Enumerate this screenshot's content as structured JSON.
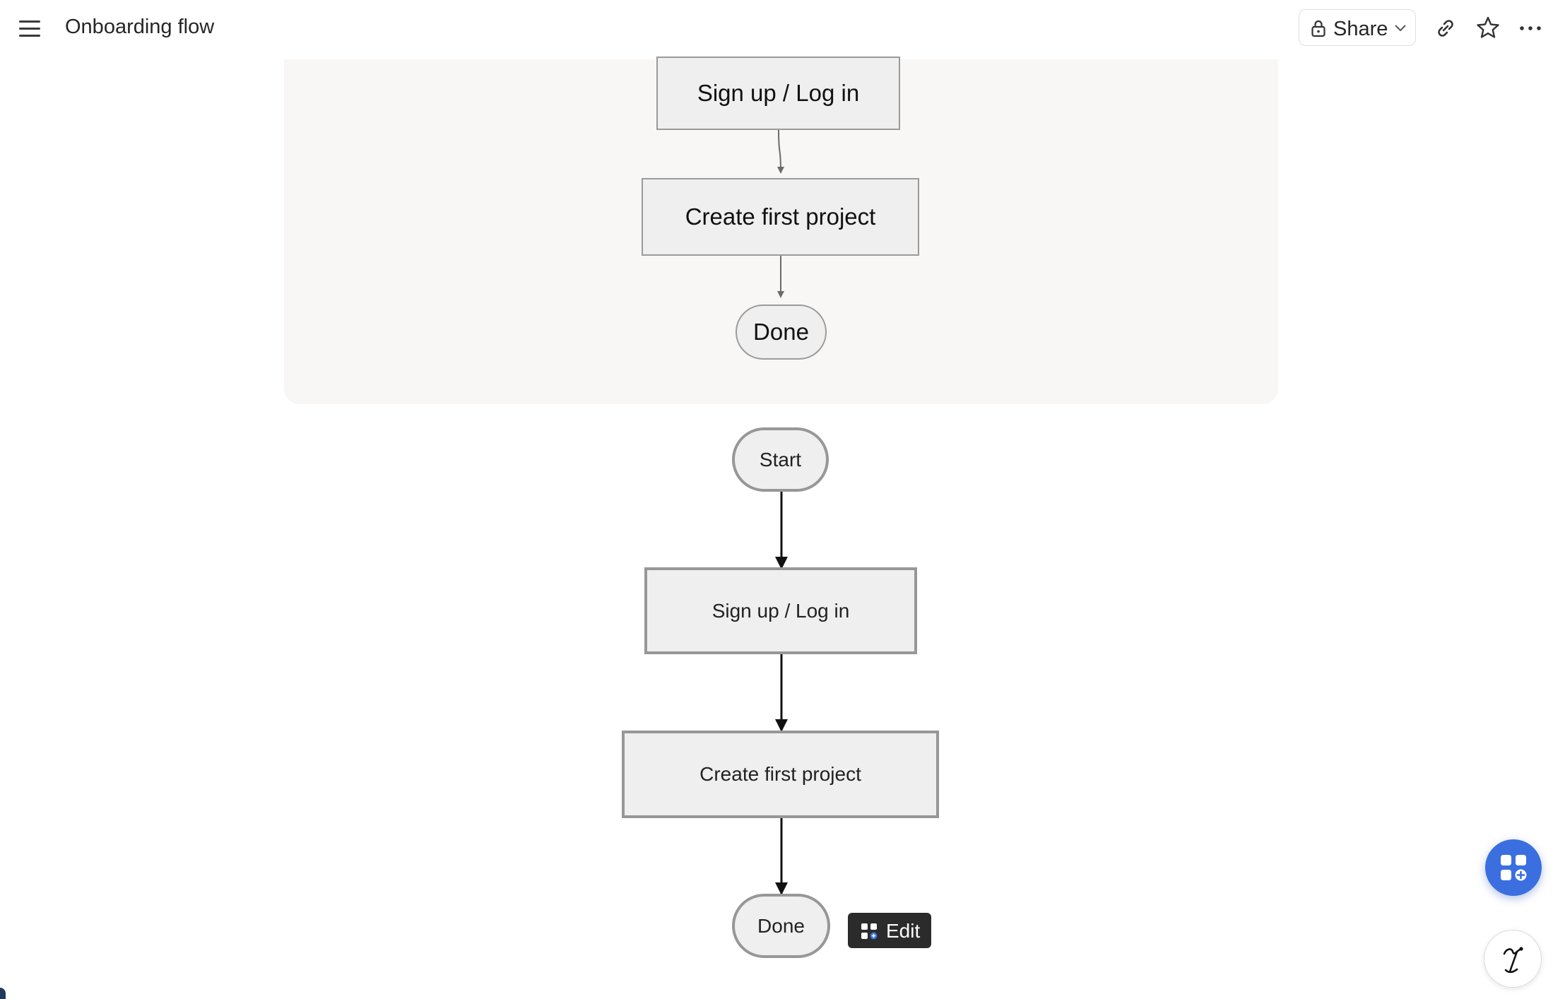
{
  "header": {
    "title": "Onboarding flow",
    "share_label": "Share"
  },
  "embedded_diagram": {
    "nodes": {
      "signup": "Sign up / Log in",
      "create_project": "Create first project",
      "done": "Done"
    }
  },
  "main_diagram": {
    "nodes": {
      "start": "Start",
      "signup": "Sign up / Log in",
      "create_project": "Create first project",
      "done": "Done"
    }
  },
  "edit_chip": {
    "label": "Edit"
  },
  "icons": {
    "menu": "menu-icon",
    "lock": "lock-icon",
    "chevron": "chevron-down-icon",
    "link": "link-icon",
    "star": "star-icon",
    "more": "more-icon",
    "apps": "apps-add-icon",
    "ai": "ai-assistant-icon"
  },
  "colors": {
    "accent": "#3b6fe0",
    "card_bg": "#f8f7f5",
    "node_fill": "#efefef",
    "node_border": "#979797",
    "edit_chip_bg": "#2b2b2b"
  }
}
